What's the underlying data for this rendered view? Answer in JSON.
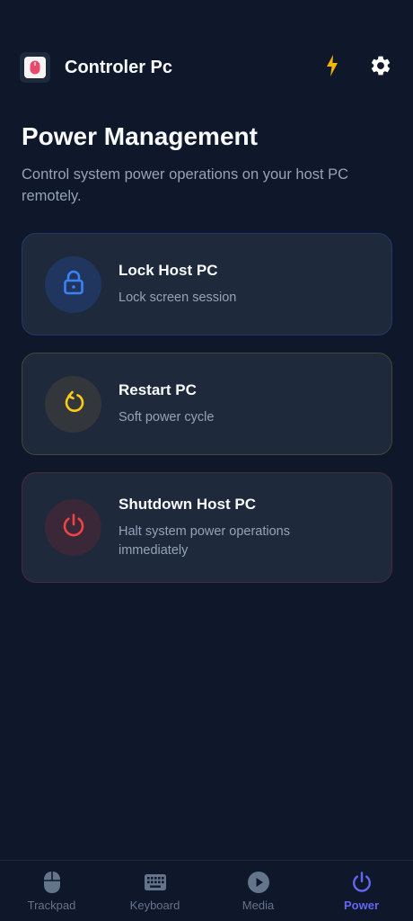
{
  "header": {
    "app_title": "Controler Pc"
  },
  "page": {
    "title": "Power Management",
    "subtitle": "Control system power operations on your host PC remotely."
  },
  "actions": [
    {
      "title": "Lock Host PC",
      "description": "Lock screen session",
      "icon": "lock-icon",
      "color": "#3b82f6"
    },
    {
      "title": "Restart PC",
      "description": "Soft power cycle",
      "icon": "restart-icon",
      "color": "#facc15"
    },
    {
      "title": "Shutdown Host PC",
      "description": "Halt system power operations immediately",
      "icon": "power-icon",
      "color": "#ef4444"
    }
  ],
  "nav": [
    {
      "label": "Trackpad",
      "icon": "mouse-icon",
      "active": false
    },
    {
      "label": "Keyboard",
      "icon": "keyboard-icon",
      "active": false
    },
    {
      "label": "Media",
      "icon": "play-icon",
      "active": false
    },
    {
      "label": "Power",
      "icon": "power-icon",
      "active": true
    }
  ],
  "colors": {
    "background": "#0f172a",
    "card": "#1e293b",
    "accent": "#6366f1",
    "flash": "#f5b400"
  }
}
